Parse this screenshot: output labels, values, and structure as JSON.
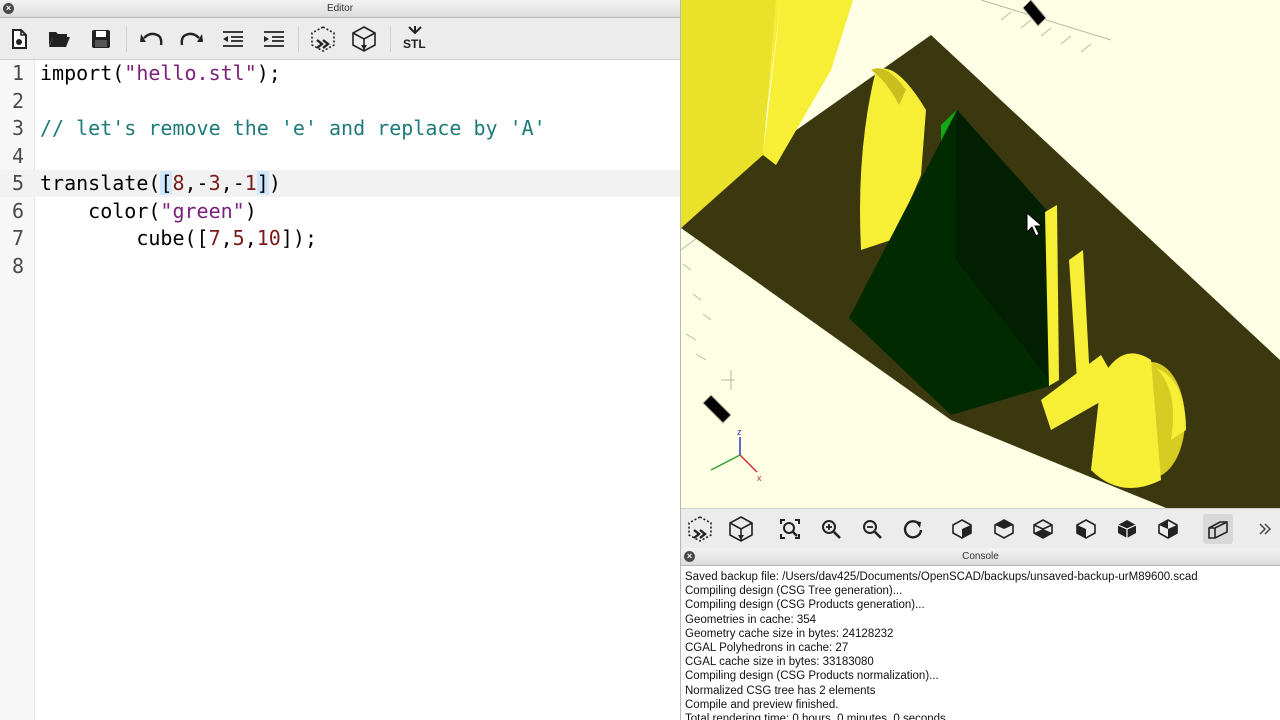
{
  "editor": {
    "title": "Editor",
    "toolbar": [
      {
        "name": "new-file-icon"
      },
      {
        "name": "open-folder-icon"
      },
      {
        "name": "save-icon"
      },
      {
        "name": "undo-icon"
      },
      {
        "name": "redo-icon"
      },
      {
        "name": "unindent-icon"
      },
      {
        "name": "indent-icon"
      },
      {
        "name": "preview-icon"
      },
      {
        "name": "render-icon"
      },
      {
        "name": "export-stl-icon",
        "label": "STL"
      }
    ],
    "lines": [
      {
        "num": "1",
        "tokens": [
          [
            "import(",
            ""
          ],
          [
            "\"hello.stl\"",
            "str"
          ],
          [
            ");",
            ""
          ]
        ]
      },
      {
        "num": "2",
        "tokens": []
      },
      {
        "num": "3",
        "tokens": [
          [
            "// let's remove the 'e' and replace by 'A'",
            "cmt"
          ]
        ]
      },
      {
        "num": "4",
        "tokens": []
      },
      {
        "num": "5",
        "current": true,
        "tokens": [
          [
            "translate(",
            ""
          ],
          [
            "[",
            "brk"
          ],
          [
            "8",
            "num"
          ],
          [
            ",-",
            ""
          ],
          [
            "3",
            "num"
          ],
          [
            ",-",
            ""
          ],
          [
            "1",
            "num"
          ],
          [
            "]",
            "brk"
          ],
          [
            ")",
            ""
          ]
        ]
      },
      {
        "num": "6",
        "tokens": [
          [
            "    color(",
            ""
          ],
          [
            "\"green\"",
            "str"
          ],
          [
            ")",
            ""
          ]
        ]
      },
      {
        "num": "7",
        "tokens": [
          [
            "        cube([",
            ""
          ],
          [
            "7",
            "num"
          ],
          [
            ",",
            ""
          ],
          [
            "5",
            "num"
          ],
          [
            ",",
            ""
          ],
          [
            "10",
            "num"
          ],
          [
            "]);",
            ""
          ]
        ]
      },
      {
        "num": "8",
        "tokens": []
      }
    ]
  },
  "view_toolbar": [
    "preview-icon",
    "render-icon",
    "zoom-all-icon",
    "zoom-in-icon",
    "zoom-out-icon",
    "reset-view-icon",
    "view-right-icon",
    "view-top-icon",
    "view-bottom-icon",
    "view-left-icon",
    "view-front-icon",
    "view-back-icon",
    "perspective-icon",
    "more-icon"
  ],
  "console": {
    "title": "Console",
    "lines": [
      "Saved backup file: /Users/dav425/Documents/OpenSCAD/backups/unsaved-backup-urM89600.scad",
      "Compiling design (CSG Tree generation)...",
      "Compiling design (CSG Products generation)...",
      "Geometries in cache: 354",
      "Geometry cache size in bytes: 24128232",
      "CGAL Polyhedrons in cache: 27",
      "CGAL cache size in bytes: 33183080",
      "Compiling design (CSG Products normalization)...",
      "Normalized CSG tree has 2 elements",
      "Compile and preview finished.",
      "Total rendering time: 0 hours, 0 minutes, 0 seconds"
    ]
  },
  "axes": {
    "z_label": "z",
    "x_label": "x"
  },
  "colors": {
    "view_bg": "#ffffe5",
    "model_dark": "#3b3810",
    "model_yellow": "#f6ef36",
    "green_face": "#14a814",
    "green_dark": "#012a01"
  }
}
